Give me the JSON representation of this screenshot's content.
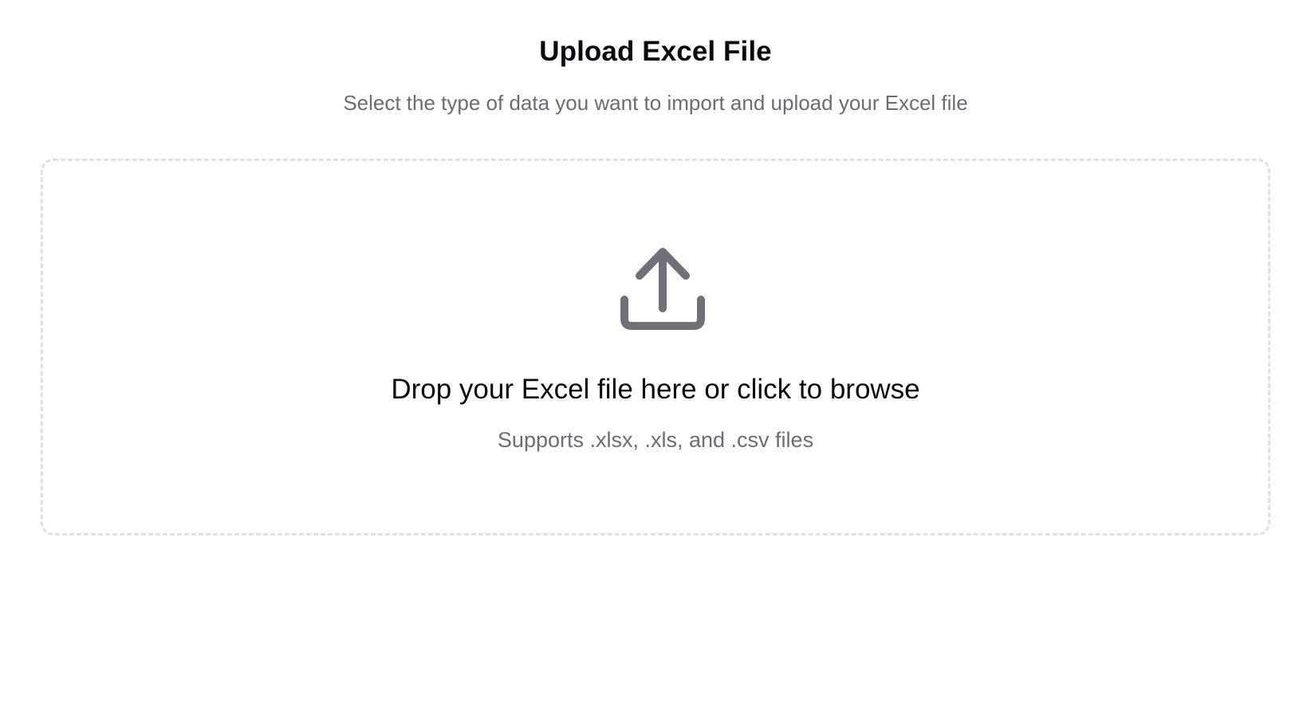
{
  "header": {
    "title": "Upload Excel File",
    "subtitle": "Select the type of data you want to import and upload your Excel file"
  },
  "dropzone": {
    "icon": "upload-icon",
    "primary_text": "Drop your Excel file here or click to browse",
    "secondary_text": "Supports .xlsx, .xls, and .csv files"
  },
  "colors": {
    "title": "#0b0b0f",
    "muted_text": "#6b6c75",
    "icon": "#6f707a",
    "dashed_border": "#e0e0e3",
    "background": "#ffffff"
  }
}
